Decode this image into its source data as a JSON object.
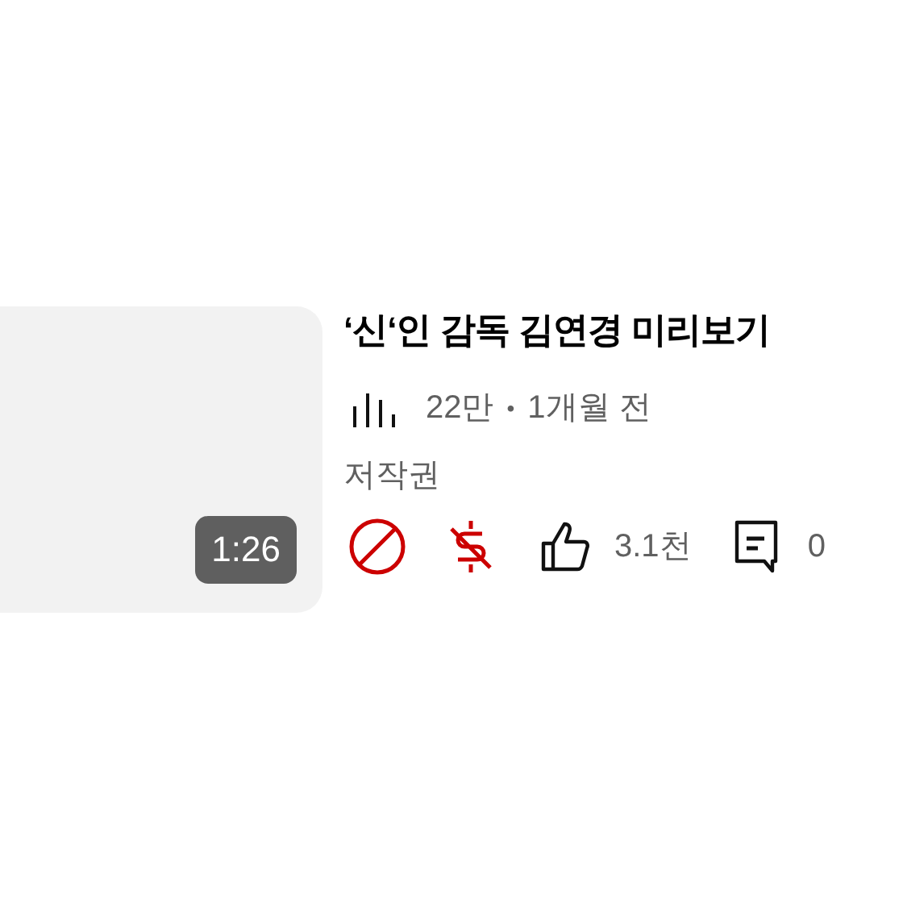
{
  "video": {
    "duration": "1:26",
    "title": "‘신‘인 감독 김연경 미리보기",
    "views": "22만",
    "separator": "•",
    "age": "1개월 전",
    "tag": "저작권",
    "likes": "3.1천",
    "comments": "0"
  }
}
